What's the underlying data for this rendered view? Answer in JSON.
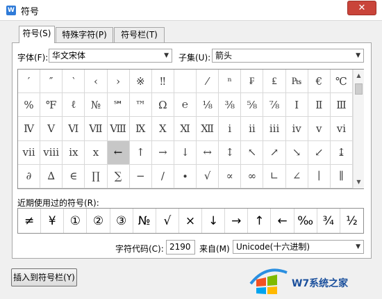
{
  "window": {
    "title": "符号",
    "app_icon": "W",
    "close_label": "✕"
  },
  "tabs": [
    {
      "label": "符号(S)",
      "active": true
    },
    {
      "label": "特殊字符(P)",
      "active": false
    },
    {
      "label": "符号栏(T)",
      "active": false
    }
  ],
  "font": {
    "label": "字体(F):",
    "value": "华文宋体"
  },
  "subset": {
    "label": "子集(U):",
    "value": "箭头"
  },
  "symbols": [
    [
      "′",
      "″",
      "‵",
      "‹",
      "›",
      "※",
      "‼",
      "",
      "⁄",
      "ⁿ",
      "₣",
      "₤",
      "₧",
      "€",
      "℃"
    ],
    [
      "%",
      "℉",
      "ℓ",
      "№",
      "℠",
      "™",
      "Ω",
      "℮",
      "⅛",
      "⅜",
      "⅝",
      "⅞",
      "Ⅰ",
      "Ⅱ",
      "Ⅲ"
    ],
    [
      "Ⅳ",
      "Ⅴ",
      "Ⅵ",
      "Ⅶ",
      "Ⅷ",
      "Ⅸ",
      "Ⅹ",
      "Ⅺ",
      "Ⅻ",
      "ⅰ",
      "ⅱ",
      "ⅲ",
      "ⅳ",
      "ⅴ",
      "ⅵ"
    ],
    [
      "ⅶ",
      "ⅷ",
      "ⅸ",
      "ⅹ",
      "←",
      "↑",
      "→",
      "↓",
      "↔",
      "↕",
      "↖",
      "↗",
      "↘",
      "↙",
      "↨"
    ],
    [
      "∂",
      "∆",
      "∈",
      "∏",
      "∑",
      "−",
      "∕",
      "∙",
      "√",
      "∝",
      "∞",
      "∟",
      "∠",
      "∣",
      "∥"
    ]
  ],
  "selected_symbol": {
    "row": 3,
    "col": 4
  },
  "recent": {
    "label": "近期使用过的符号(R):",
    "items": [
      "≠",
      "¥",
      "①",
      "②",
      "③",
      "№",
      "√",
      "×",
      "↓",
      "→",
      "↑",
      "←",
      "‰",
      "¾",
      "½"
    ]
  },
  "char_code": {
    "label": "字符代码(C):",
    "value": "2190"
  },
  "from": {
    "label": "来自(M)",
    "value": "Unicode(十六进制)"
  },
  "insert_button": {
    "label": "插入到符号栏(Y)"
  },
  "watermark": {
    "text": "W7系统之家"
  }
}
